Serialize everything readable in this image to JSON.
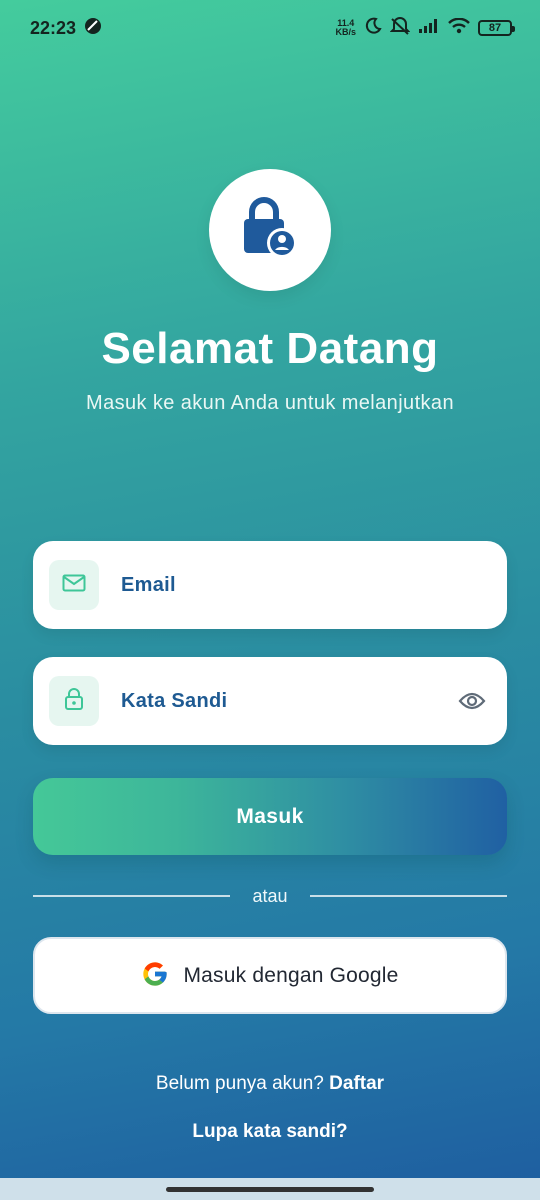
{
  "status_bar": {
    "time": "22:23",
    "net_speed_value": "11.4",
    "net_speed_unit": "KB/s",
    "battery": "87"
  },
  "header": {
    "title": "Selamat Datang",
    "subtitle": "Masuk ke akun Anda untuk melanjutkan"
  },
  "form": {
    "email_placeholder": "Email",
    "password_placeholder": "Kata Sandi"
  },
  "actions": {
    "login_label": "Masuk",
    "divider_text": "atau",
    "google_label": "Masuk dengan Google"
  },
  "footer": {
    "signup_prompt": "Belum punya akun?",
    "signup_link": "Daftar",
    "forgot_password": "Lupa kata sandi?"
  },
  "colors": {
    "accent_green": "#44cc9d",
    "accent_blue": "#1e5da0",
    "label_blue": "#1e5a92"
  }
}
